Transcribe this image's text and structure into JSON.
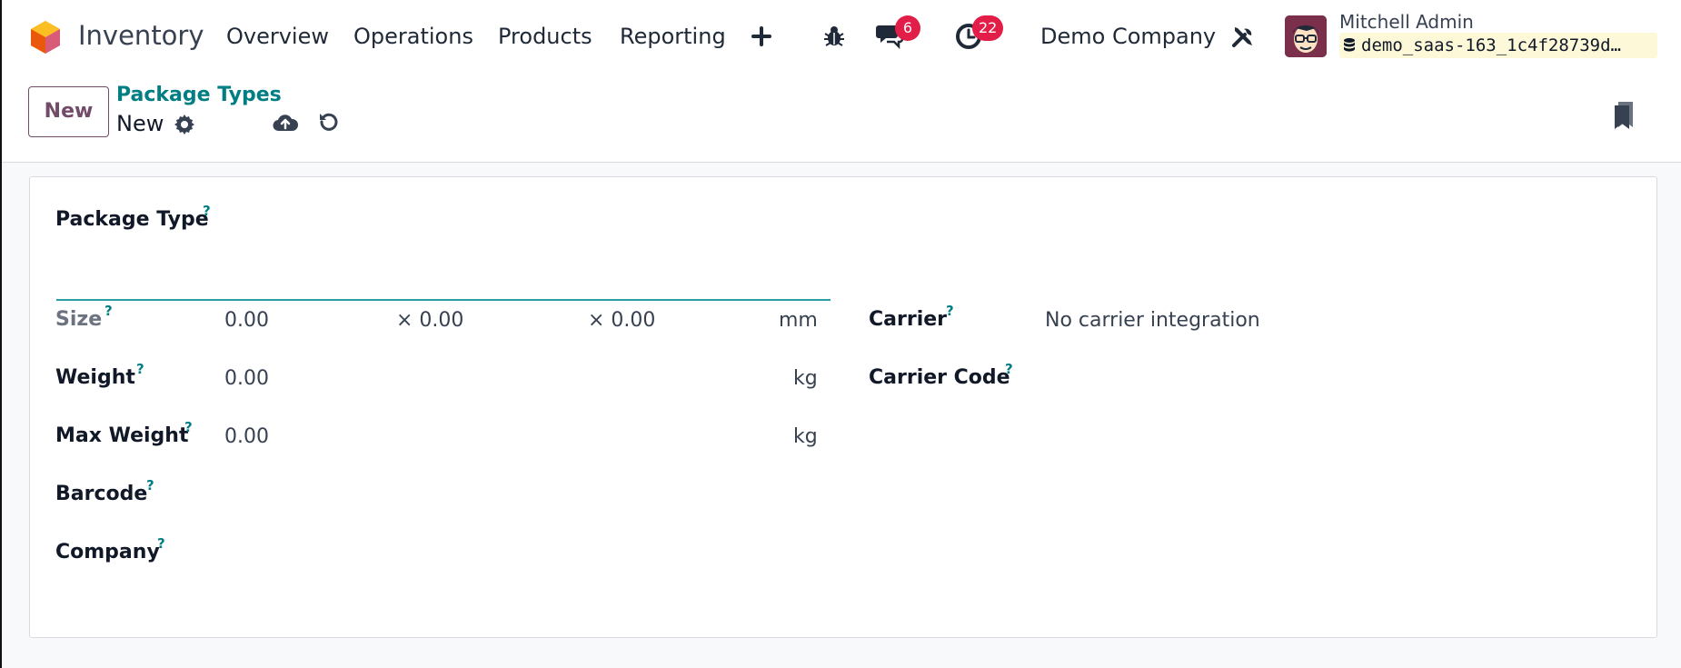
{
  "navbar": {
    "app_name": "Inventory",
    "menu": [
      "Overview",
      "Operations",
      "Products",
      "Reporting"
    ],
    "add_icon": "plus-icon",
    "debug_icon": "bug-icon",
    "messages_icon": "chat-icon",
    "messages_count": "6",
    "activities_icon": "clock-icon",
    "activities_count": "22",
    "company": "Demo Company",
    "tools_icon": "tools-icon",
    "user_name": "Mitchell Admin",
    "database": "demo_saas-163_1c4f28739d…",
    "colors": {
      "brand_logo": "#f59e0b",
      "badge": "#e11d48"
    }
  },
  "control_panel": {
    "new_button": "New",
    "breadcrumb_parent": "Package Types",
    "breadcrumb_current": "New",
    "settings_icon": "gear-icon",
    "save_icon": "cloud-upload-icon",
    "discard_icon": "undo-icon",
    "bookmark_icon": "bookmark-icon",
    "colors": {
      "primary": "#714b67",
      "link": "#017e84"
    }
  },
  "form": {
    "name_label": "Package Type",
    "name_value": "",
    "help_mark": "?",
    "size": {
      "label": "Size",
      "length": "0.00",
      "width": "× 0.00",
      "height": "× 0.00",
      "unit": "mm"
    },
    "weight": {
      "label": "Weight",
      "value": "0.00",
      "unit": "kg"
    },
    "max_weight": {
      "label": "Max Weight",
      "value": "0.00",
      "unit": "kg"
    },
    "barcode": {
      "label": "Barcode",
      "value": ""
    },
    "company": {
      "label": "Company",
      "value": ""
    },
    "carrier": {
      "label": "Carrier",
      "value": "No carrier integration"
    },
    "carrier_code": {
      "label": "Carrier Code",
      "value": ""
    }
  }
}
